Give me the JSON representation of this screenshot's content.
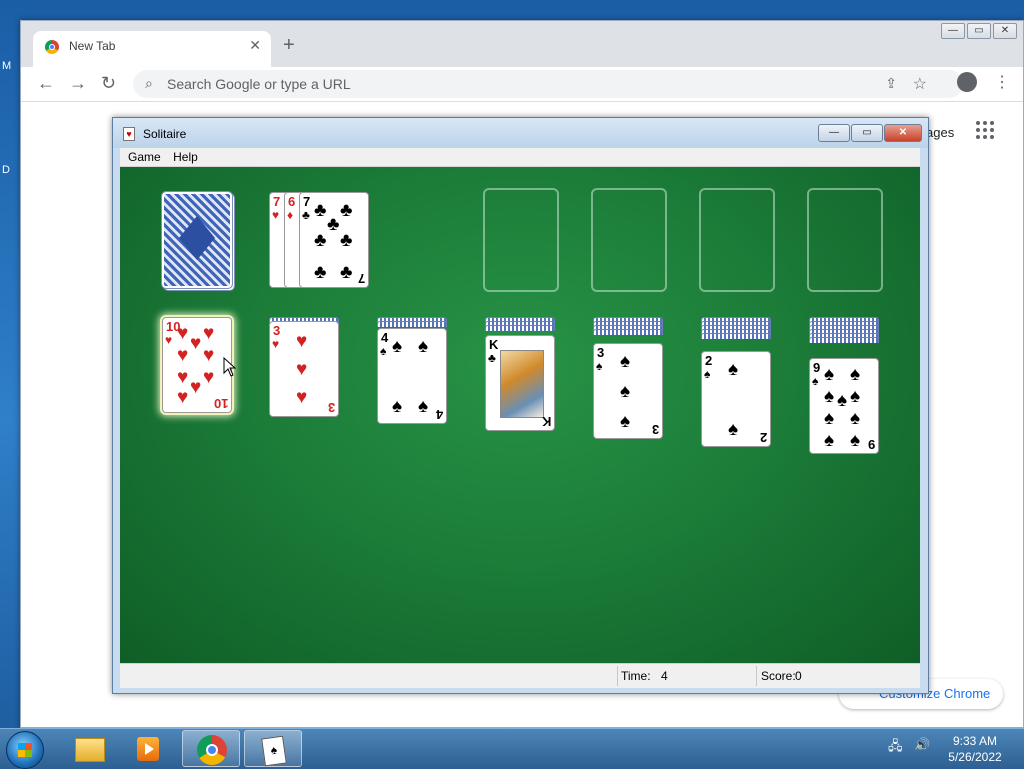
{
  "desktop": {
    "frag_top": "M",
    "frag_mid": "D"
  },
  "chrome": {
    "tab_title": "New Tab",
    "tab_close": "✕",
    "new_tab": "+",
    "window_controls": [
      "—",
      "▭",
      "✕"
    ],
    "nav": {
      "back": "←",
      "forward": "→",
      "reload": "↻"
    },
    "omnibox_placeholder": "Search Google or type a URL",
    "images_link": "ages",
    "customize_label": "Customize Chrome"
  },
  "solitaire": {
    "title": "Solitaire",
    "window_controls": [
      "—",
      "▭",
      "✕"
    ],
    "menu": [
      "Game",
      "Help"
    ],
    "status": {
      "time_label": "Time:",
      "time_value": "4",
      "score_label": "Score:",
      "score_value": "0"
    },
    "waste": [
      {
        "rank": "7",
        "suit": "♥",
        "color": "red"
      },
      {
        "rank": "6",
        "suit": "♦",
        "color": "red"
      },
      {
        "rank": "7",
        "suit": "♣",
        "color": "black"
      }
    ],
    "tableau": [
      {
        "hidden": 0,
        "rank": "10",
        "suit": "♥",
        "color": "red",
        "selected": true
      },
      {
        "hidden": 1,
        "rank": "3",
        "suit": "♥",
        "color": "red"
      },
      {
        "hidden": 2,
        "rank": "4",
        "suit": "♠",
        "color": "black"
      },
      {
        "hidden": 3,
        "rank": "K",
        "suit": "♣",
        "color": "black",
        "face_card": true
      },
      {
        "hidden": 4,
        "rank": "3",
        "suit": "♠",
        "color": "black"
      },
      {
        "hidden": 5,
        "rank": "2",
        "suit": "♠",
        "color": "black"
      },
      {
        "hidden": 6,
        "rank": "9",
        "suit": "♠",
        "color": "black"
      }
    ],
    "foundations_empty": 4
  },
  "taskbar": {
    "clock_time": "9:33 AM",
    "clock_date": "5/26/2022",
    "sol_icon_glyph": "♠"
  }
}
